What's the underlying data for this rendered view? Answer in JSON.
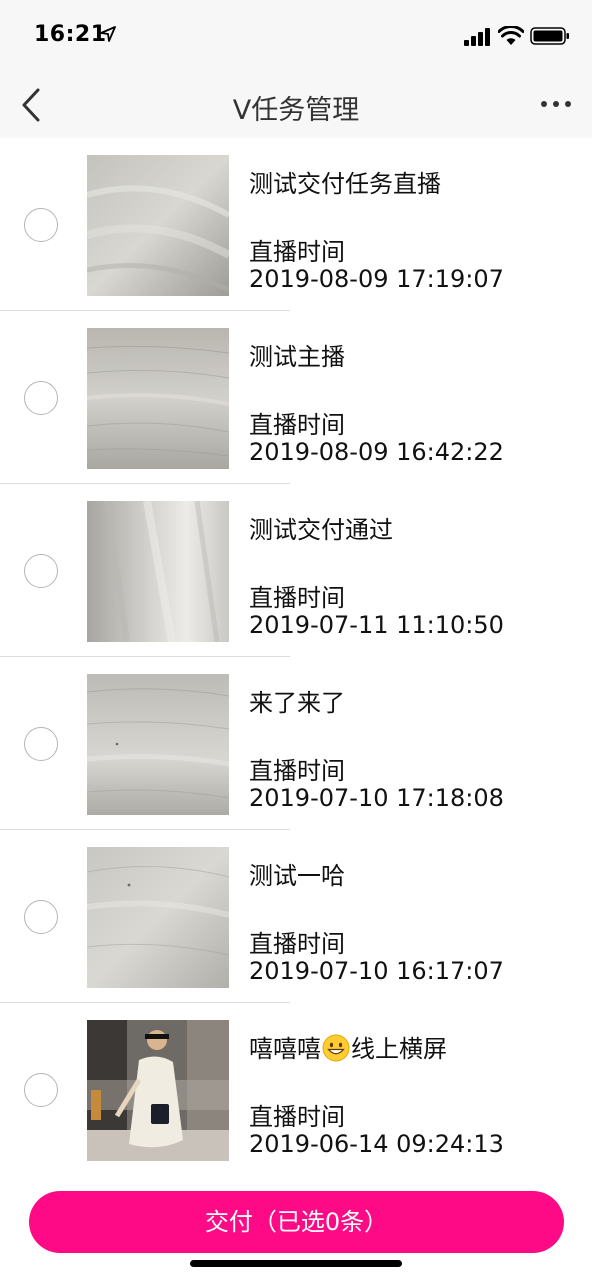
{
  "status_bar": {
    "time": "16:21",
    "icons": [
      "location-arrow-icon",
      "signal-icon",
      "wifi-icon",
      "battery-icon"
    ]
  },
  "nav": {
    "title": "V任务管理",
    "back_icon": "chevron-left-icon",
    "more_icon": "more-dots-icon"
  },
  "list": {
    "items": [
      {
        "title": "测试交付任务直播",
        "label": "直播时间",
        "time": "2019-08-09 17:19:07",
        "thumbnail": "gray-fabric-texture"
      },
      {
        "title": "测试主播",
        "label": "直播时间",
        "time": "2019-08-09 16:42:22",
        "thumbnail": "gray-wood-texture"
      },
      {
        "title": "测试交付通过",
        "label": "直播时间",
        "time": "2019-07-11 11:10:50",
        "thumbnail": "blurred-gray-texture"
      },
      {
        "title": "来了来了",
        "label": "直播时间",
        "time": "2019-07-10 17:18:08",
        "thumbnail": "gray-wood-texture"
      },
      {
        "title": "测试一哈",
        "label": "直播时间",
        "time": "2019-07-10 16:17:07",
        "thumbnail": "gray-wood-texture"
      },
      {
        "title_before": "嘻嘻嘻",
        "title_emoji": "grinning-face-emoji",
        "title_after": "线上横屏",
        "label": "直播时间",
        "time": "2019-06-14 09:24:13",
        "thumbnail": "street-fashion-photo"
      }
    ]
  },
  "footer": {
    "submit_label": "交付（已选0条）"
  },
  "colors": {
    "accent": "#ff0a86",
    "nav_background": "#f7f7f7",
    "divider": "#dcdcdc",
    "radio_border": "#b5b5b5"
  }
}
